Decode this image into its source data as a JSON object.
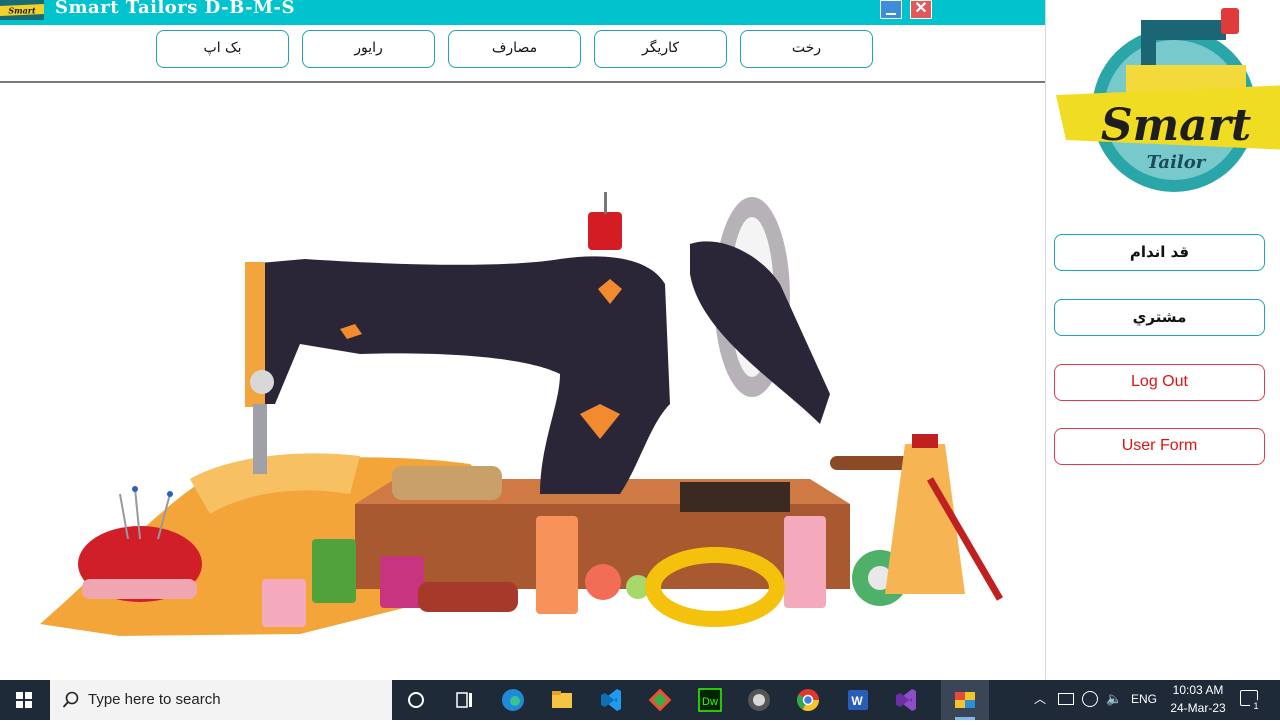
{
  "window": {
    "title": "Smart Tailors D-B-M-S",
    "logo_text": "Smart"
  },
  "top_nav": {
    "items": [
      {
        "label": "رخت"
      },
      {
        "label": "کاریگر"
      },
      {
        "label": "مصارف"
      },
      {
        "label": "رایور"
      },
      {
        "label": "بک اپ"
      }
    ]
  },
  "brand_logo": {
    "title": "Smart",
    "subtitle": "Tailor"
  },
  "side_menu": {
    "items": [
      {
        "label": "قد اندام"
      },
      {
        "label": "مشتري"
      },
      {
        "label": "Log Out"
      },
      {
        "label": "User Form"
      }
    ]
  },
  "taskbar": {
    "search_placeholder": "Type here to search",
    "language": "ENG",
    "time": "10:03 AM",
    "date": "24-Mar-23",
    "notification_count": "1",
    "pinned_apps": [
      "cortana-icon",
      "task-view-icon",
      "edge-icon",
      "file-explorer-icon",
      "vscode-icon",
      "git-icon",
      "dreamweaver-icon",
      "media-player-icon",
      "chrome-icon",
      "word-icon",
      "visual-studio-icon",
      "smart-tailors-app-icon"
    ]
  },
  "colors": {
    "titlebar": "#00c3cd",
    "button_border": "#1fa3b5",
    "danger": "#e01414",
    "taskbar": "#1f2a38"
  }
}
